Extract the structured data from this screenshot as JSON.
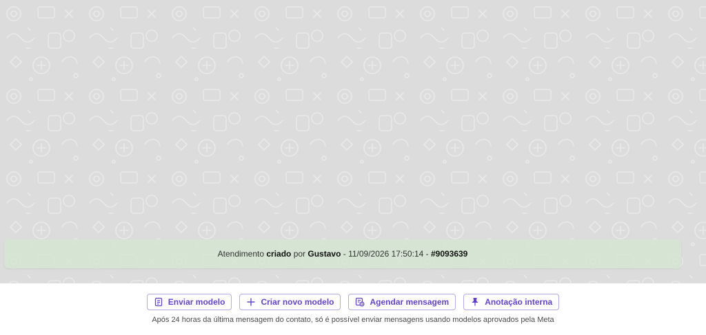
{
  "system_message": {
    "prefix": "Atendimento ",
    "action": "criado",
    "by": " por ",
    "user": "Gustavo",
    "separator": " - ",
    "datetime": "11/09/2026 17:50:14",
    "separator2": " - ",
    "ticket": "#9093639"
  },
  "toolbar": {
    "send_template": "Enviar modelo",
    "create_template": "Criar novo modelo",
    "schedule_message": "Agendar mensagem",
    "internal_note": "Anotação interna"
  },
  "notice": "Após 24 horas da última mensagem do contato, só é possível enviar mensagens usando modelos aprovados pela Meta",
  "colors": {
    "accent": "#6243c8",
    "banner_bg": "#d5e5d1",
    "chat_bg": "#dcdcdc"
  }
}
